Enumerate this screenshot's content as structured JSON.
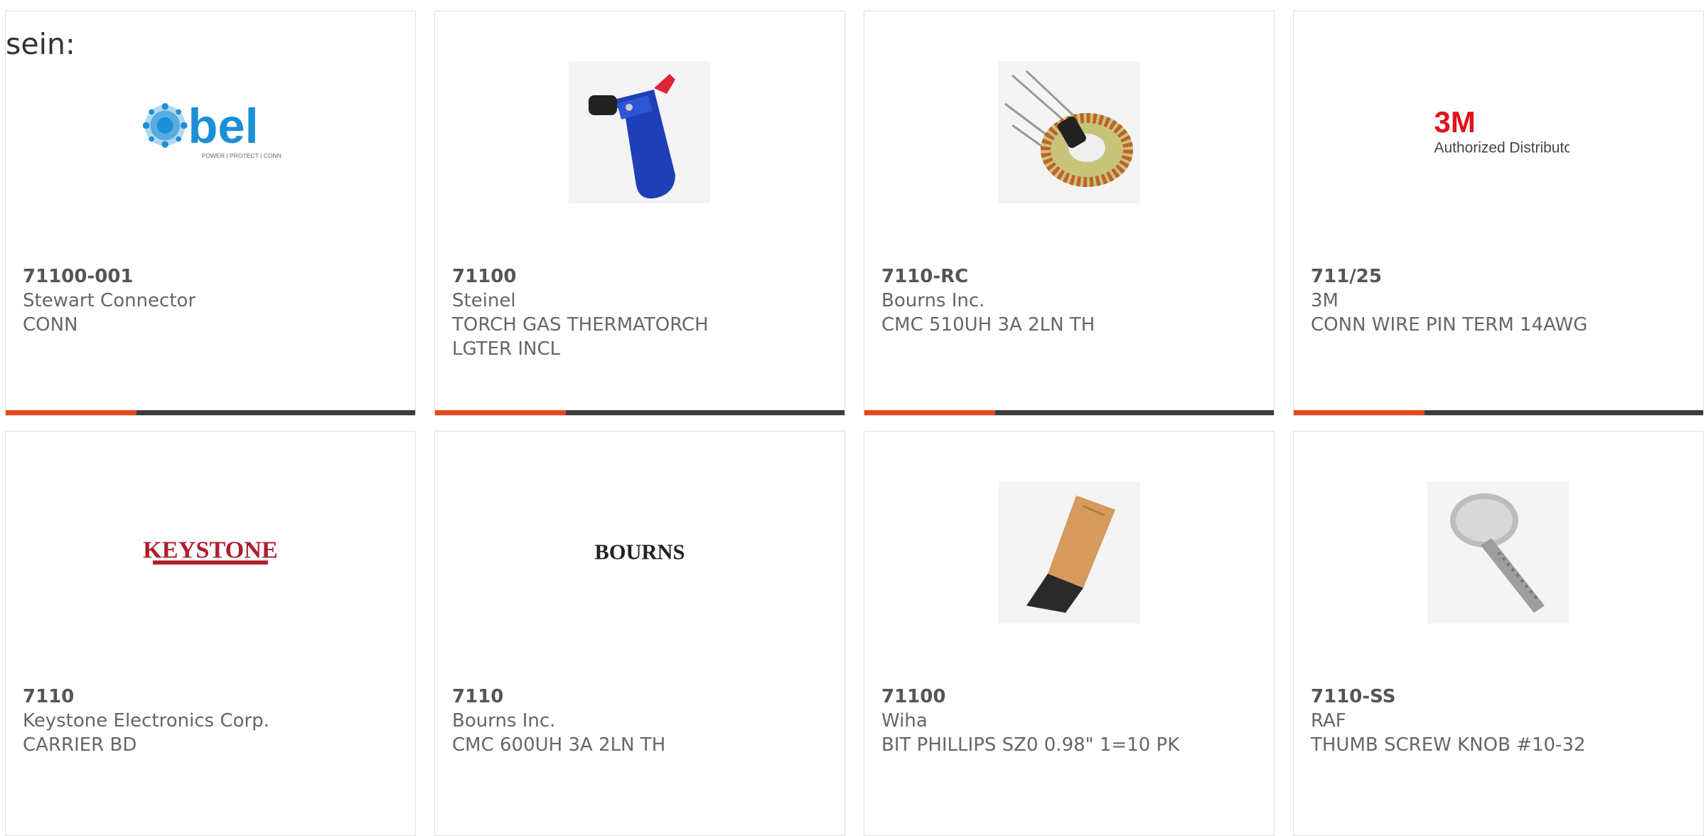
{
  "intro_text": "sein:",
  "colors": {
    "accent": "#e8471a",
    "bar_track": "#3c3c3c",
    "card_border": "#dddddd"
  },
  "products": [
    {
      "part": "71100-001",
      "manufacturer": "Stewart Connector",
      "description": "CONN",
      "image": "bel-logo",
      "logo_text": "bel",
      "logo_tagline": "POWER | PROTECT | CONNECT",
      "progress": 0.32
    },
    {
      "part": "71100",
      "manufacturer": "Steinel",
      "description": "TORCH GAS THERMATORCH LGTER INCL",
      "image": "torch-photo",
      "progress": 0.32
    },
    {
      "part": "7110-RC",
      "manufacturer": "Bourns Inc.",
      "description": "CMC 510UH 3A 2LN TH",
      "image": "toroid-photo",
      "progress": 0.32
    },
    {
      "part": "711/25",
      "manufacturer": "3M",
      "description": "CONN WIRE PIN TERM 14AWG",
      "image": "3m-logo",
      "logo_text": "3M",
      "logo_tagline": "Authorized Distributor",
      "progress": 0.32
    },
    {
      "part": "7110",
      "manufacturer": "Keystone Electronics Corp.",
      "description": "CARRIER BD",
      "image": "keystone-logo",
      "logo_text": "KEYSTONE"
    },
    {
      "part": "7110",
      "manufacturer": "Bourns Inc.",
      "description": "CMC 600UH 3A 2LN TH",
      "image": "bourns-logo",
      "logo_text": "BOURNS"
    },
    {
      "part": "71100",
      "manufacturer": "Wiha",
      "description": "BIT PHILLIPS SZ0 0.98\" 1=10 PK",
      "image": "bit-photo"
    },
    {
      "part": "7110-SS",
      "manufacturer": "RAF",
      "description": "THUMB SCREW KNOB #10-32",
      "image": "thumbscrew-photo"
    }
  ]
}
